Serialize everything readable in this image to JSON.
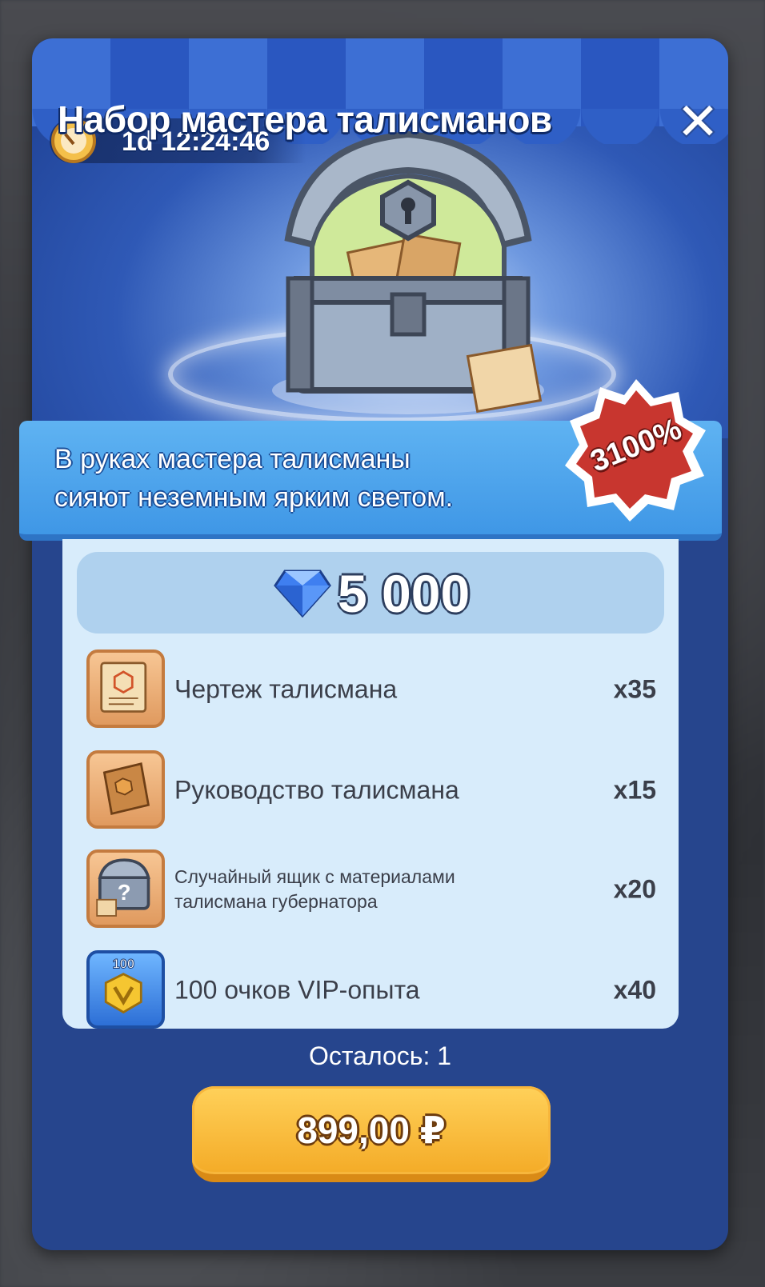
{
  "offer": {
    "title": "Набор мастера талисманов",
    "timer": "1d 12:24:46",
    "description_line1": "В руках мастера талисманы",
    "description_line2": "сияют неземным ярким светом.",
    "discount": "3100%"
  },
  "price_bar": {
    "gems": "5 000",
    "icon": "diamond-icon"
  },
  "rewards": [
    {
      "label": "Чертеж талисмана",
      "count": "x35",
      "icon": "blueprint-scroll-icon"
    },
    {
      "label": "Руководство талисмана",
      "count": "x15",
      "icon": "guide-book-icon"
    },
    {
      "label_line1": "Случайный ящик с материалами",
      "label_line2": "талисмана губернатора",
      "count": "x20",
      "icon": "material-chest-icon"
    },
    {
      "label": "100 очков VIP-опыта",
      "count": "x40",
      "icon": "vip-exp-icon",
      "badge": "100"
    }
  ],
  "footer": {
    "remaining": "Осталось: 1",
    "buy_price": "899,00 ₽"
  },
  "colors": {
    "panel": "#26458d",
    "banner": "#4aa3ec",
    "content": "#d8ecfb",
    "button": "#f4ab27",
    "badge": "#c8362f"
  }
}
